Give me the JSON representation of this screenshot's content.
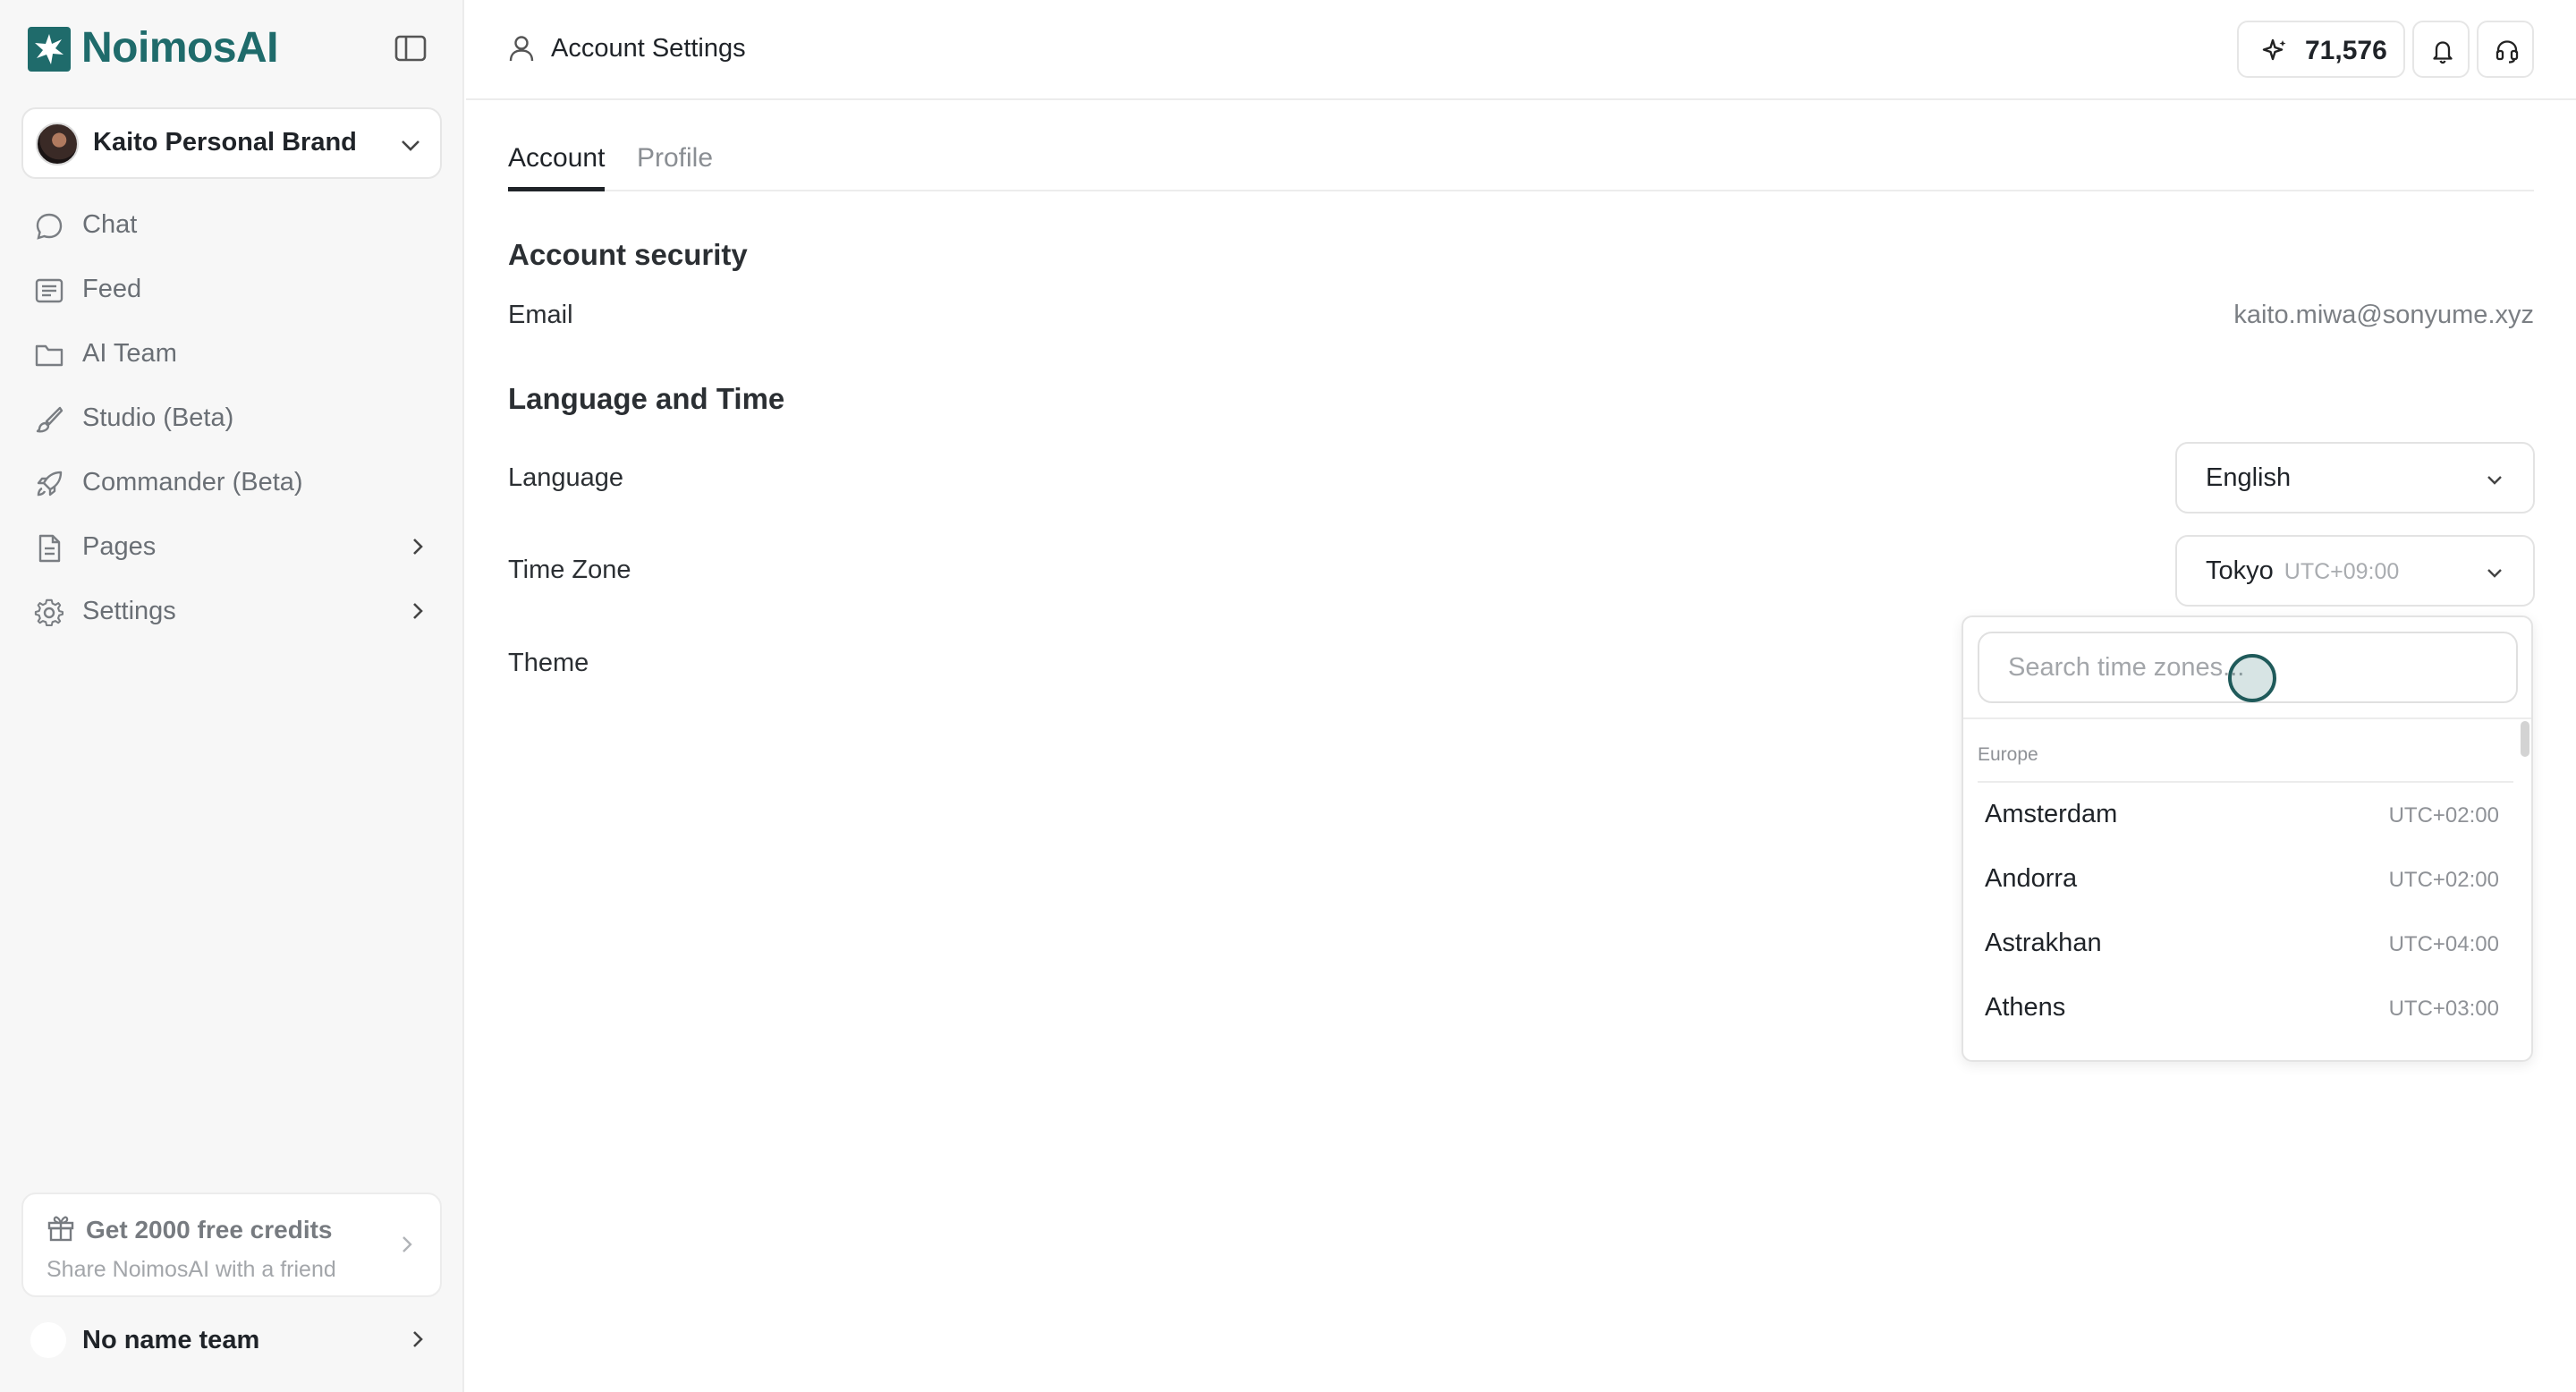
{
  "app": {
    "name": "NoimosAI",
    "accent_color": "#1f6b6b"
  },
  "sidebar": {
    "brand_selector": {
      "name": "Kaito Personal Brand"
    },
    "items": [
      {
        "label": "Chat",
        "icon": "chat-bubble-icon"
      },
      {
        "label": "Feed",
        "icon": "feed-list-icon"
      },
      {
        "label": "AI Team",
        "icon": "folder-icon"
      },
      {
        "label": "Studio (Beta)",
        "icon": "brush-icon"
      },
      {
        "label": "Commander (Beta)",
        "icon": "rocket-icon"
      },
      {
        "label": "Pages",
        "icon": "document-icon",
        "has_submenu": true
      },
      {
        "label": "Settings",
        "icon": "gear-icon",
        "has_submenu": true
      }
    ],
    "invite_card": {
      "title": "Get 2000 free credits",
      "subtitle": "Share NoimosAI with a friend"
    },
    "team": {
      "name": "No name team"
    }
  },
  "header": {
    "title": "Account Settings",
    "credits": "71,576"
  },
  "tabs": [
    {
      "label": "Account",
      "active": true
    },
    {
      "label": "Profile",
      "active": false
    }
  ],
  "account_security": {
    "heading": "Account security",
    "email_label": "Email",
    "email_value": "kaito.miwa@sonyume.xyz"
  },
  "language_time": {
    "heading": "Language and Time",
    "language_label": "Language",
    "language_value": "English",
    "timezone_label": "Time Zone",
    "timezone_value": "Tokyo",
    "timezone_offset": "UTC+09:00",
    "theme_label": "Theme"
  },
  "timezone_dropdown": {
    "search_placeholder": "Search time zones...",
    "group": "Europe",
    "options": [
      {
        "city": "Amsterdam",
        "offset": "UTC+02:00"
      },
      {
        "city": "Andorra",
        "offset": "UTC+02:00"
      },
      {
        "city": "Astrakhan",
        "offset": "UTC+04:00"
      },
      {
        "city": "Athens",
        "offset": "UTC+03:00"
      }
    ]
  }
}
